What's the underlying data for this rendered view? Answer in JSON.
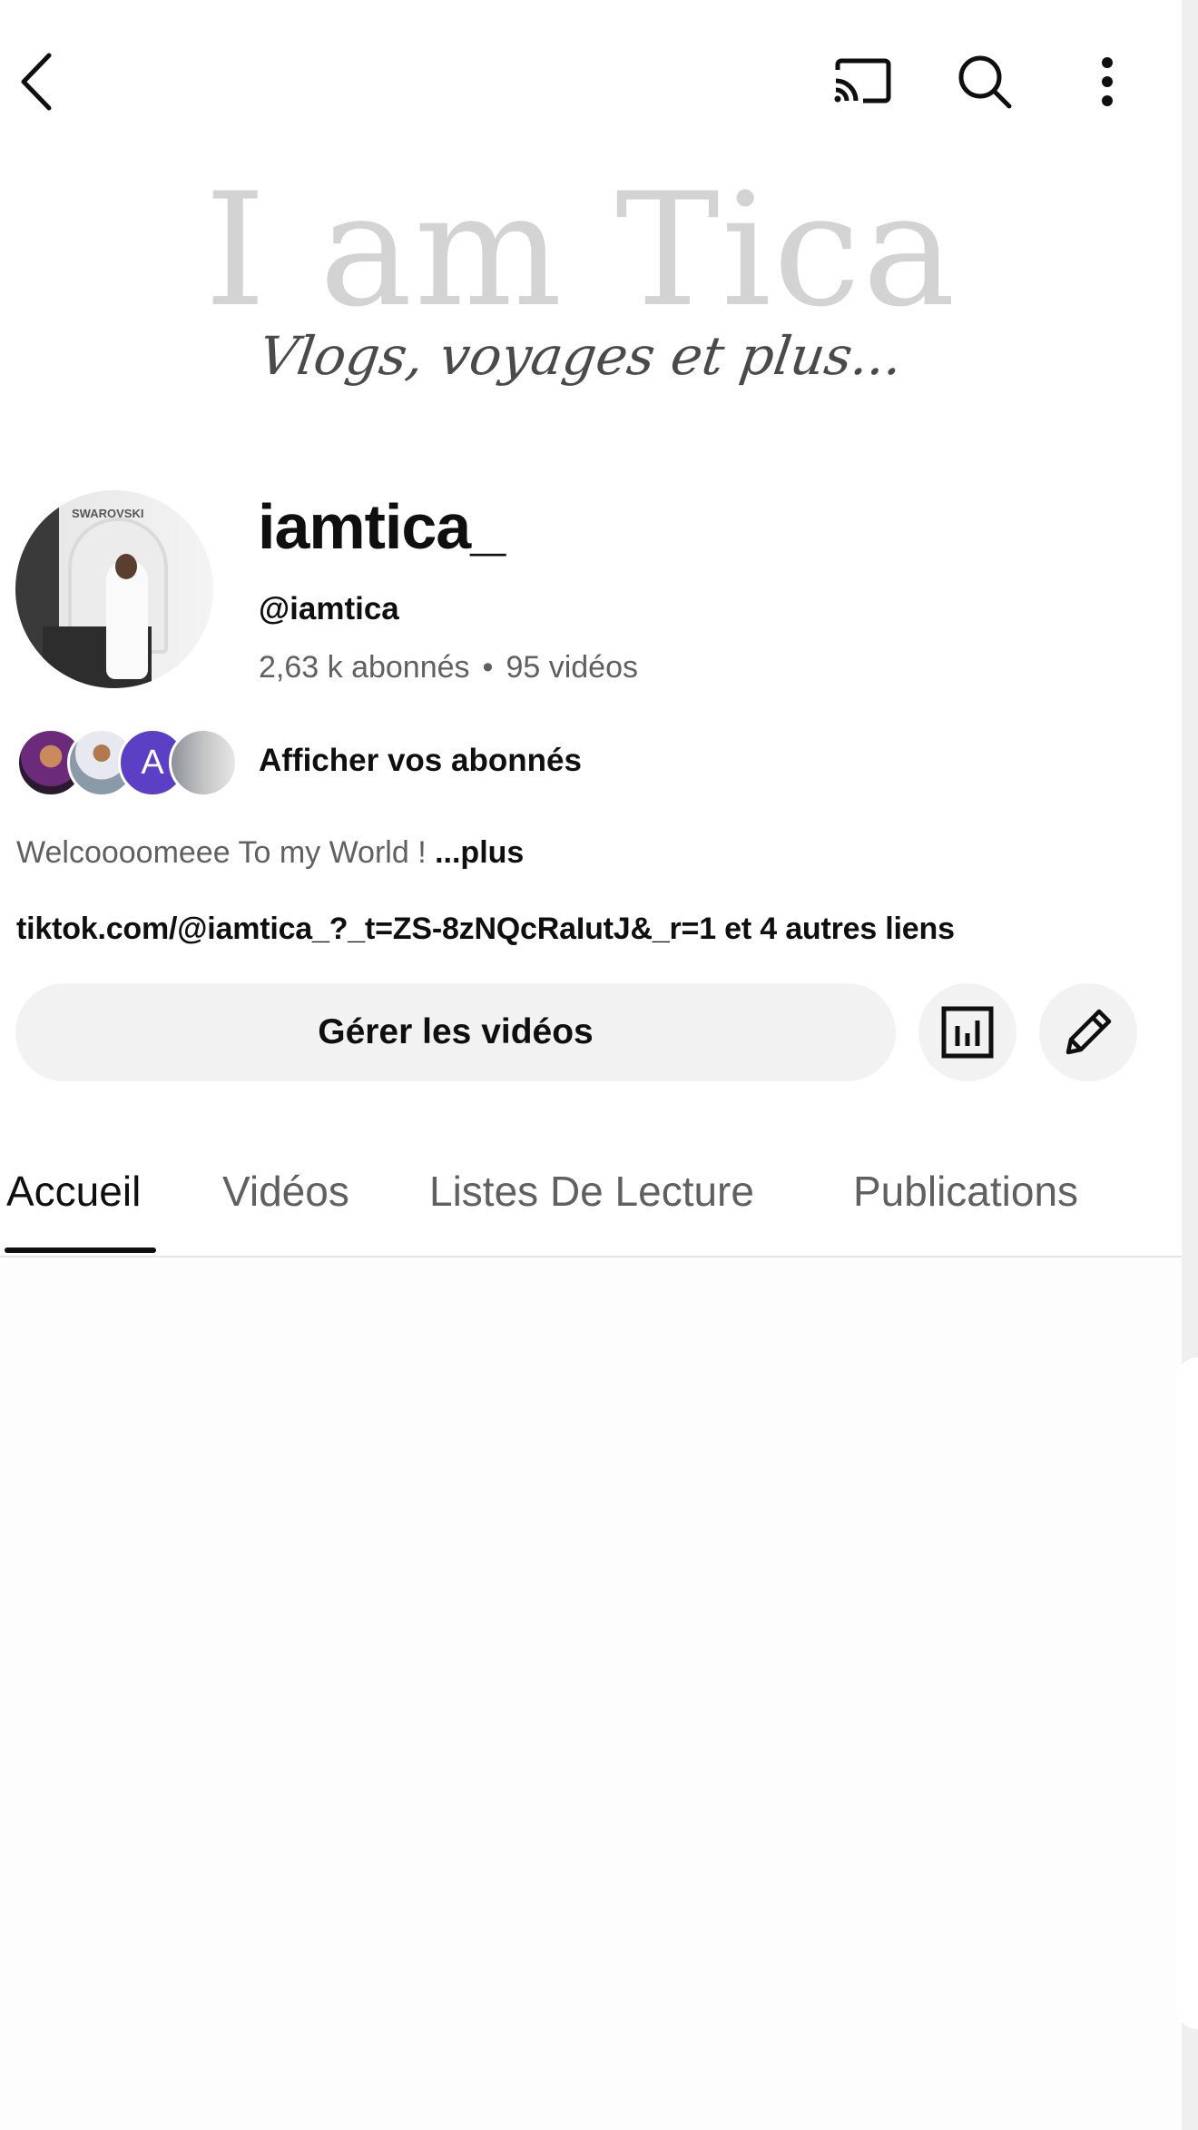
{
  "banner": {
    "title": "I am Tica",
    "subtitle": "Vlogs, voyages et plus..."
  },
  "profile": {
    "channel_name": "iamtica_",
    "handle": "@iamtica",
    "subscribers": "2,63 k abonnés",
    "separator": "•",
    "videos": "95 vidéos",
    "avatar_sign": "SWAROVSKI"
  },
  "subscribers_row": {
    "avatar_letter": "A",
    "label": "Afficher vos abonnés"
  },
  "description": {
    "text": "Welcoooomeee To my World ! ",
    "more_label": "...plus"
  },
  "links": {
    "text": "tiktok.com/@iamtica_?_t=ZS-8zNQcRaIutJ&_r=1 et 4 autres liens"
  },
  "actions": {
    "manage_videos_label": "Gérer les vidéos",
    "stats_icon": "analytics-icon",
    "edit_icon": "pencil-icon"
  },
  "top_bar": {
    "back_icon": "back-arrow-icon",
    "cast_icon": "cast-icon",
    "search_icon": "search-icon",
    "more_icon": "more-vertical-icon"
  },
  "tabs": [
    {
      "label": "Accueil",
      "active": true
    },
    {
      "label": "Vidéos",
      "active": false
    },
    {
      "label": "Listes De Lecture",
      "active": false
    },
    {
      "label": "Publications",
      "active": false
    }
  ],
  "colors": {
    "text_primary": "#0f0f0f",
    "text_secondary": "#606060",
    "button_bg": "#f2f2f2",
    "avatar_a": "#5b3fc4",
    "banner_title": "#d3d3d3"
  }
}
